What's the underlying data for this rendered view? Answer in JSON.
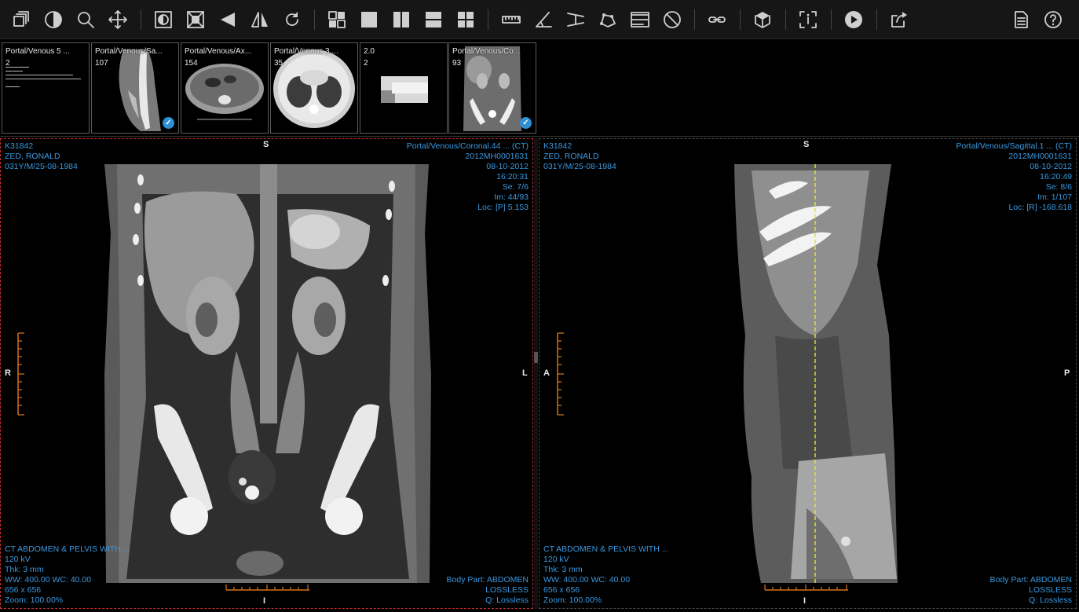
{
  "toolbar": {
    "buttons": [
      {
        "name": "series-stack-icon"
      },
      {
        "name": "window-level-icon"
      },
      {
        "name": "zoom-icon"
      },
      {
        "name": "pan-icon"
      },
      {
        "name": "invert-icon"
      },
      {
        "name": "fit-to-window-icon"
      },
      {
        "name": "flip-horizontal-icon"
      },
      {
        "name": "flip-vertical-icon"
      },
      {
        "name": "rotate-icon"
      },
      {
        "name": "layout-custom-icon"
      },
      {
        "name": "layout-1x1-icon"
      },
      {
        "name": "layout-1x2-icon"
      },
      {
        "name": "layout-2x1-icon"
      },
      {
        "name": "layout-2x2-icon"
      },
      {
        "name": "length-measure-icon"
      },
      {
        "name": "angle-measure-icon"
      },
      {
        "name": "cobb-angle-icon"
      },
      {
        "name": "roi-freehand-icon"
      },
      {
        "name": "annotation-text-icon"
      },
      {
        "name": "clear-annotations-icon"
      },
      {
        "name": "link-series-icon"
      },
      {
        "name": "3d-cube-icon"
      },
      {
        "name": "dicom-info-icon"
      },
      {
        "name": "cine-play-icon"
      },
      {
        "name": "share-icon"
      },
      {
        "name": "report-icon"
      },
      {
        "name": "help-icon"
      }
    ]
  },
  "thumbnails": [
    {
      "label": "Portal/Venous 5 ...",
      "count": "2",
      "kind": "text",
      "checked": false
    },
    {
      "label": "Portal/Venous/Sa...",
      "count": "107",
      "kind": "sagittal",
      "checked": true
    },
    {
      "label": "Portal/Venous/Ax...",
      "count": "154",
      "kind": "axial",
      "checked": false
    },
    {
      "label": "Portal/Venous 3....",
      "count": "35",
      "kind": "lung",
      "checked": false
    },
    {
      "label": "2.0",
      "count": "2",
      "kind": "scout",
      "checked": false
    },
    {
      "label": "Portal/Venous/Co...",
      "count": "93",
      "kind": "coronal",
      "checked": true
    }
  ],
  "viewports": {
    "left": {
      "top_left": [
        "K31842",
        "ZED, RONALD",
        "031Y/M/25-08-1984"
      ],
      "top_right": [
        "Portal/Venous/Coronal.44 ... (CT)",
        "2012MH0001631",
        "08-10-2012",
        "16:20:31",
        "Se: 7/6",
        "Im: 44/93",
        "Loc: [P] 5.153"
      ],
      "bottom_left": [
        "CT ABDOMEN & PELVIS WITH ...",
        "120 kV",
        "Thk: 3 mm",
        "WW: 400.00 WC: 40.00",
        "656 x 656",
        "Zoom: 100.00%"
      ],
      "bottom_right": [
        "Body Part: ABDOMEN",
        "LOSSLESS",
        "Q: Lossless"
      ],
      "orient_top": "S",
      "orient_bottom": "I",
      "orient_left": "R",
      "orient_right": "L",
      "active": true
    },
    "right": {
      "top_left": [
        "K31842",
        "ZED, RONALD",
        "031Y/M/25-08-1984"
      ],
      "top_right": [
        "Portal/Venous/Sagittal.1 ... (CT)",
        "2012MH0001631",
        "08-10-2012",
        "16:20:49",
        "Se: 8/6",
        "Im: 1/107",
        "Loc: [R] -168.618"
      ],
      "bottom_left": [
        "CT ABDOMEN & PELVIS WITH ...",
        "120 kV",
        "Thk: 3 mm",
        "WW: 400.00 WC: 40.00",
        "656 x 656",
        "Zoom: 100.00%"
      ],
      "bottom_right": [
        "Body Part: ABDOMEN",
        "LOSSLESS",
        "Q: Lossless"
      ],
      "orient_top": "S",
      "orient_bottom": "I",
      "orient_left": "A",
      "orient_right": "P",
      "active": false
    }
  },
  "colors": {
    "overlay_text": "#3a98e0",
    "active_border": "#c43030",
    "scale_bar": "#d4731c",
    "reference_line": "#e8e032",
    "check_badge": "#2d8fd4"
  }
}
